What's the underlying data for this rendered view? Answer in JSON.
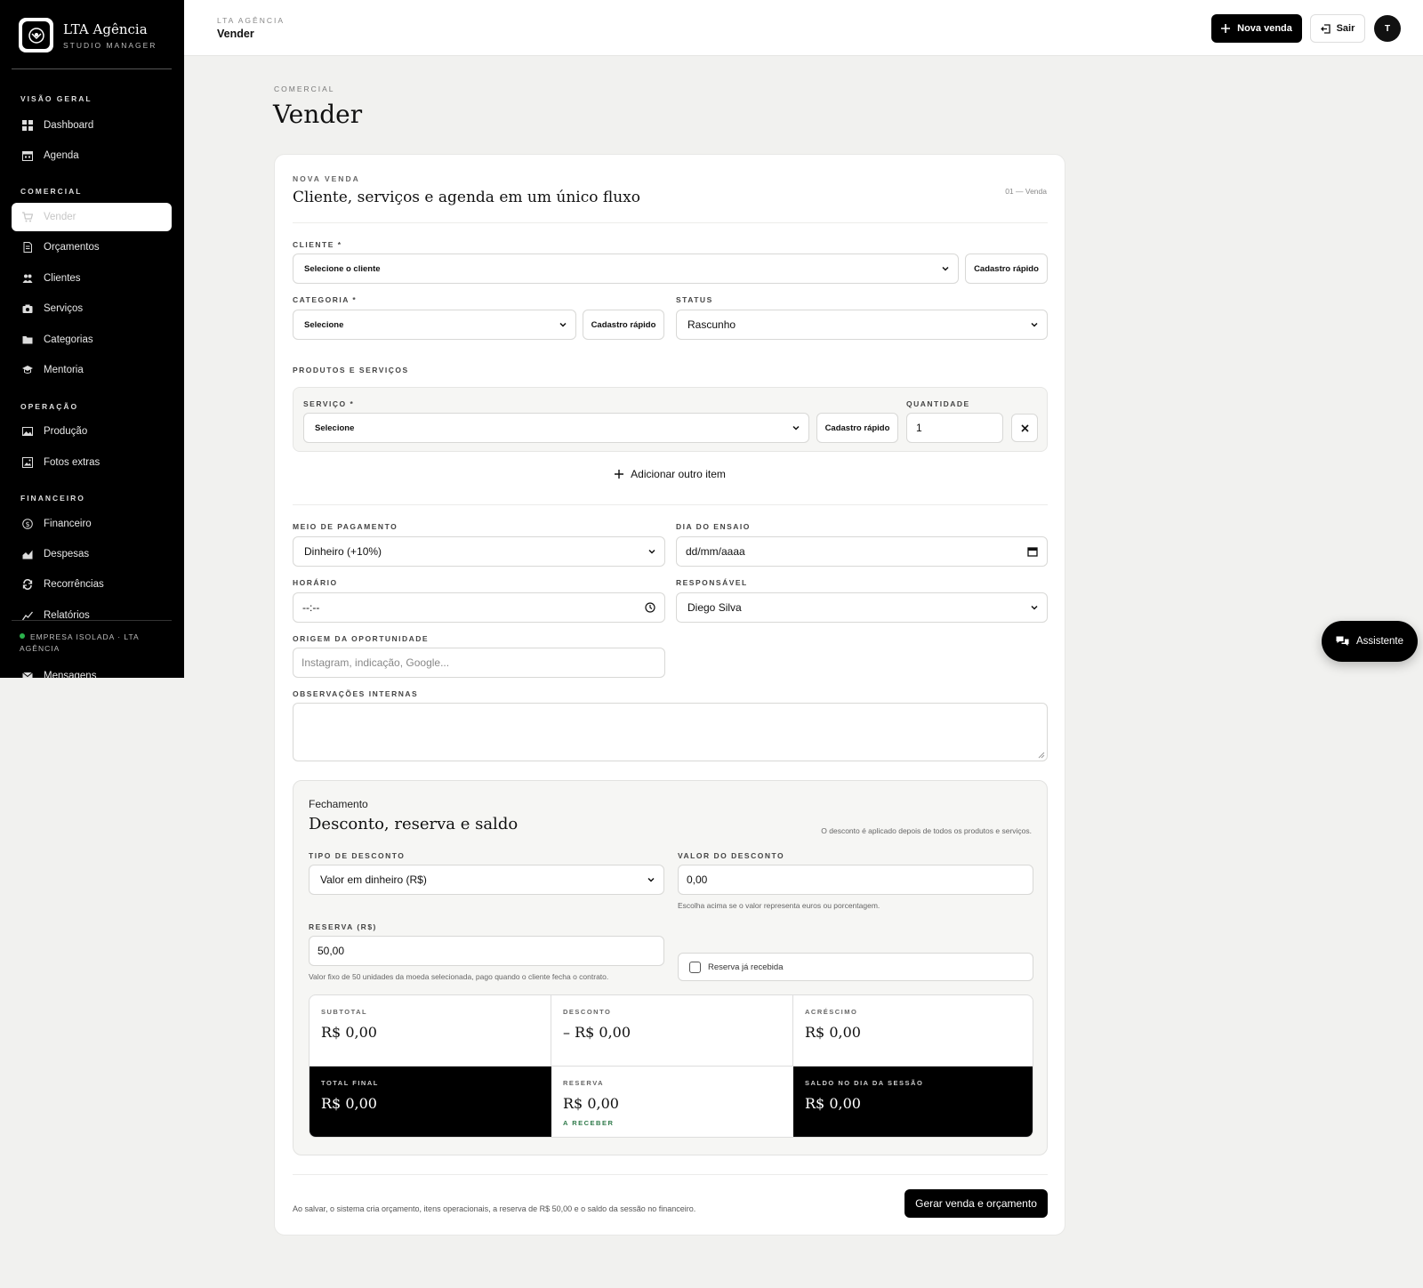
{
  "brand": {
    "name": "LTA Agência",
    "subtitle": "STUDIO MANAGER"
  },
  "sidebar": {
    "sections": [
      {
        "title": "VISÃO GERAL"
      },
      {
        "title": "COMERCIAL"
      },
      {
        "title": "OPERAÇÃO"
      },
      {
        "title": "FINANCEIRO"
      }
    ],
    "items": [
      {
        "label": "Dashboard",
        "icon": "grid-icon"
      },
      {
        "label": "Agenda",
        "icon": "calendar-icon"
      },
      {
        "label": "Vender",
        "icon": "cart-icon",
        "active": true
      },
      {
        "label": "Orçamentos",
        "icon": "document-icon"
      },
      {
        "label": "Clientes",
        "icon": "users-icon"
      },
      {
        "label": "Serviços",
        "icon": "camera-icon"
      },
      {
        "label": "Categorias",
        "icon": "folder-icon"
      },
      {
        "label": "Mentoria",
        "icon": "graduation-cap-icon"
      },
      {
        "label": "Produção",
        "icon": "image-icon"
      },
      {
        "label": "Fotos extras",
        "icon": "gallery-icon"
      },
      {
        "label": "Financeiro",
        "icon": "dollar-icon"
      },
      {
        "label": "Despesas",
        "icon": "area-chart-icon"
      },
      {
        "label": "Recorrências",
        "icon": "repeat-icon"
      },
      {
        "label": "Relatórios",
        "icon": "line-chart-icon"
      },
      {
        "label": "Mensagens",
        "icon": "mail-icon"
      }
    ],
    "status": "EMPRESA ISOLADA · LTA AGÊNCIA",
    "status_color": "#2bb24c"
  },
  "topbar": {
    "eyebrow": "LTA AGÊNCIA",
    "title": "Vender",
    "new_sale_label": "Nova venda",
    "exit_label": "Sair",
    "avatar_initial": "T"
  },
  "page": {
    "eyebrow": "COMERCIAL",
    "title": "Vender"
  },
  "form": {
    "eyebrow": "NOVA VENDA",
    "title": "Cliente, serviços e agenda em um único fluxo",
    "step": "01 — Venda",
    "cliente": {
      "label": "CLIENTE *",
      "value": "Selecione o cliente",
      "quick": "Cadastro rápido"
    },
    "categoria": {
      "label": "CATEGORIA *",
      "value": "Selecione",
      "quick": "Cadastro rápido"
    },
    "status": {
      "label": "STATUS",
      "value": "Rascunho"
    },
    "products_title": "PRODUTOS E SERVIÇOS",
    "servico": {
      "label": "SERVIÇO *",
      "value": "Selecione",
      "quick": "Cadastro rápido"
    },
    "quantidade": {
      "label": "QUANTIDADE",
      "value": "1"
    },
    "add_item": "Adicionar outro item",
    "pagamento": {
      "label": "MEIO DE PAGAMENTO",
      "value": "Dinheiro (+10%)"
    },
    "dia": {
      "label": "DIA DO ENSAIO",
      "value": "dd/mm/aaaa"
    },
    "horario": {
      "label": "HORÁRIO",
      "value": "--:--"
    },
    "responsavel": {
      "label": "RESPONSÁVEL",
      "value": "Diego Silva"
    },
    "origem": {
      "label": "ORIGEM DA OPORTUNIDADE",
      "placeholder": "Instagram, indicação, Google..."
    },
    "observacoes": {
      "label": "OBSERVAÇÕES INTERNAS"
    }
  },
  "closing": {
    "eyebrow": "Fechamento",
    "title": "Desconto, reserva e saldo",
    "note": "O desconto é aplicado depois de todos os produtos e serviços.",
    "tipo": {
      "label": "TIPO DE DESCONTO",
      "value": "Valor em dinheiro (R$)"
    },
    "valor": {
      "label": "VALOR DO DESCONTO",
      "value": "0,00",
      "hint": "Escolha acima se o valor representa euros ou porcentagem."
    },
    "reserva": {
      "label": "RESERVA (R$)",
      "value": "50,00",
      "hint": "Valor fixo de 50 unidades da moeda selecionada, pago quando o cliente fecha o contrato."
    },
    "reserva_recebida": "Reserva já recebida",
    "summary": {
      "subtotal": {
        "label": "SUBTOTAL",
        "value": "R$ 0,00"
      },
      "desconto": {
        "label": "DESCONTO",
        "value": "– R$ 0,00"
      },
      "acrescimo": {
        "label": "ACRÉSCIMO",
        "value": "R$ 0,00"
      },
      "total": {
        "label": "TOTAL FINAL",
        "value": "R$ 0,00"
      },
      "reserva": {
        "label": "RESERVA",
        "value": "R$ 0,00",
        "sub": "A RECEBER"
      },
      "saldo": {
        "label": "SALDO NO DIA DA SESSÃO",
        "value": "R$ 0,00"
      }
    }
  },
  "footer": {
    "note": "Ao salvar, o sistema cria orçamento, itens operacionais, a reserva de R$ 50,00 e o saldo da sessão no financeiro.",
    "submit": "Gerar venda e orçamento"
  },
  "assistant": {
    "label": "Assistente"
  },
  "colors": {
    "accent": "#000000",
    "background": "#f1f1ef",
    "success": "#2f7a4a"
  }
}
